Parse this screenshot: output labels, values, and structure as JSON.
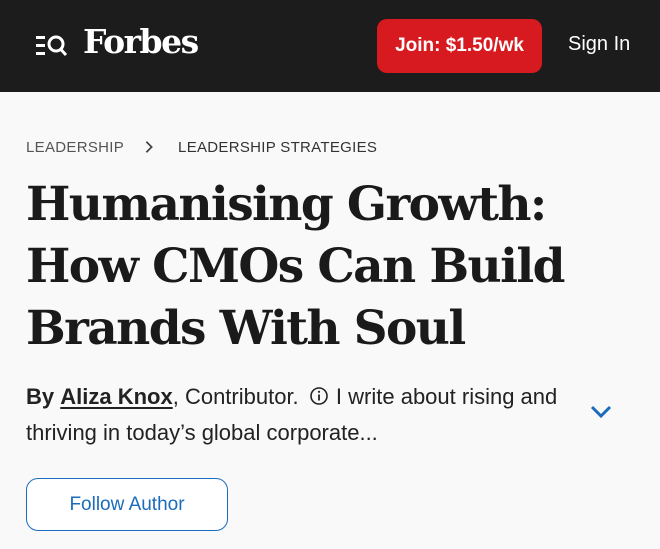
{
  "header": {
    "logo": "Forbes",
    "join_label": "Join: $1.50/wk",
    "signin_label": "Sign In",
    "menu_icon": "menu-search-icon"
  },
  "breadcrumb": [
    "LEADERSHIP",
    "LEADERSHIP STRATEGIES"
  ],
  "article": {
    "title": "Humanising Growth: How CMOs Can Build Brands With Soul",
    "byline": {
      "by": "By",
      "author": "Aliza Knox",
      "role": ", Contributor.",
      "bio": "I write about rising and thriving in today’s global corporate..."
    },
    "follow_label": "Follow Author"
  },
  "colors": {
    "header_bg": "#1c1c1c",
    "join_bg": "#d71a1f",
    "accent_blue": "#1b6cbc"
  }
}
